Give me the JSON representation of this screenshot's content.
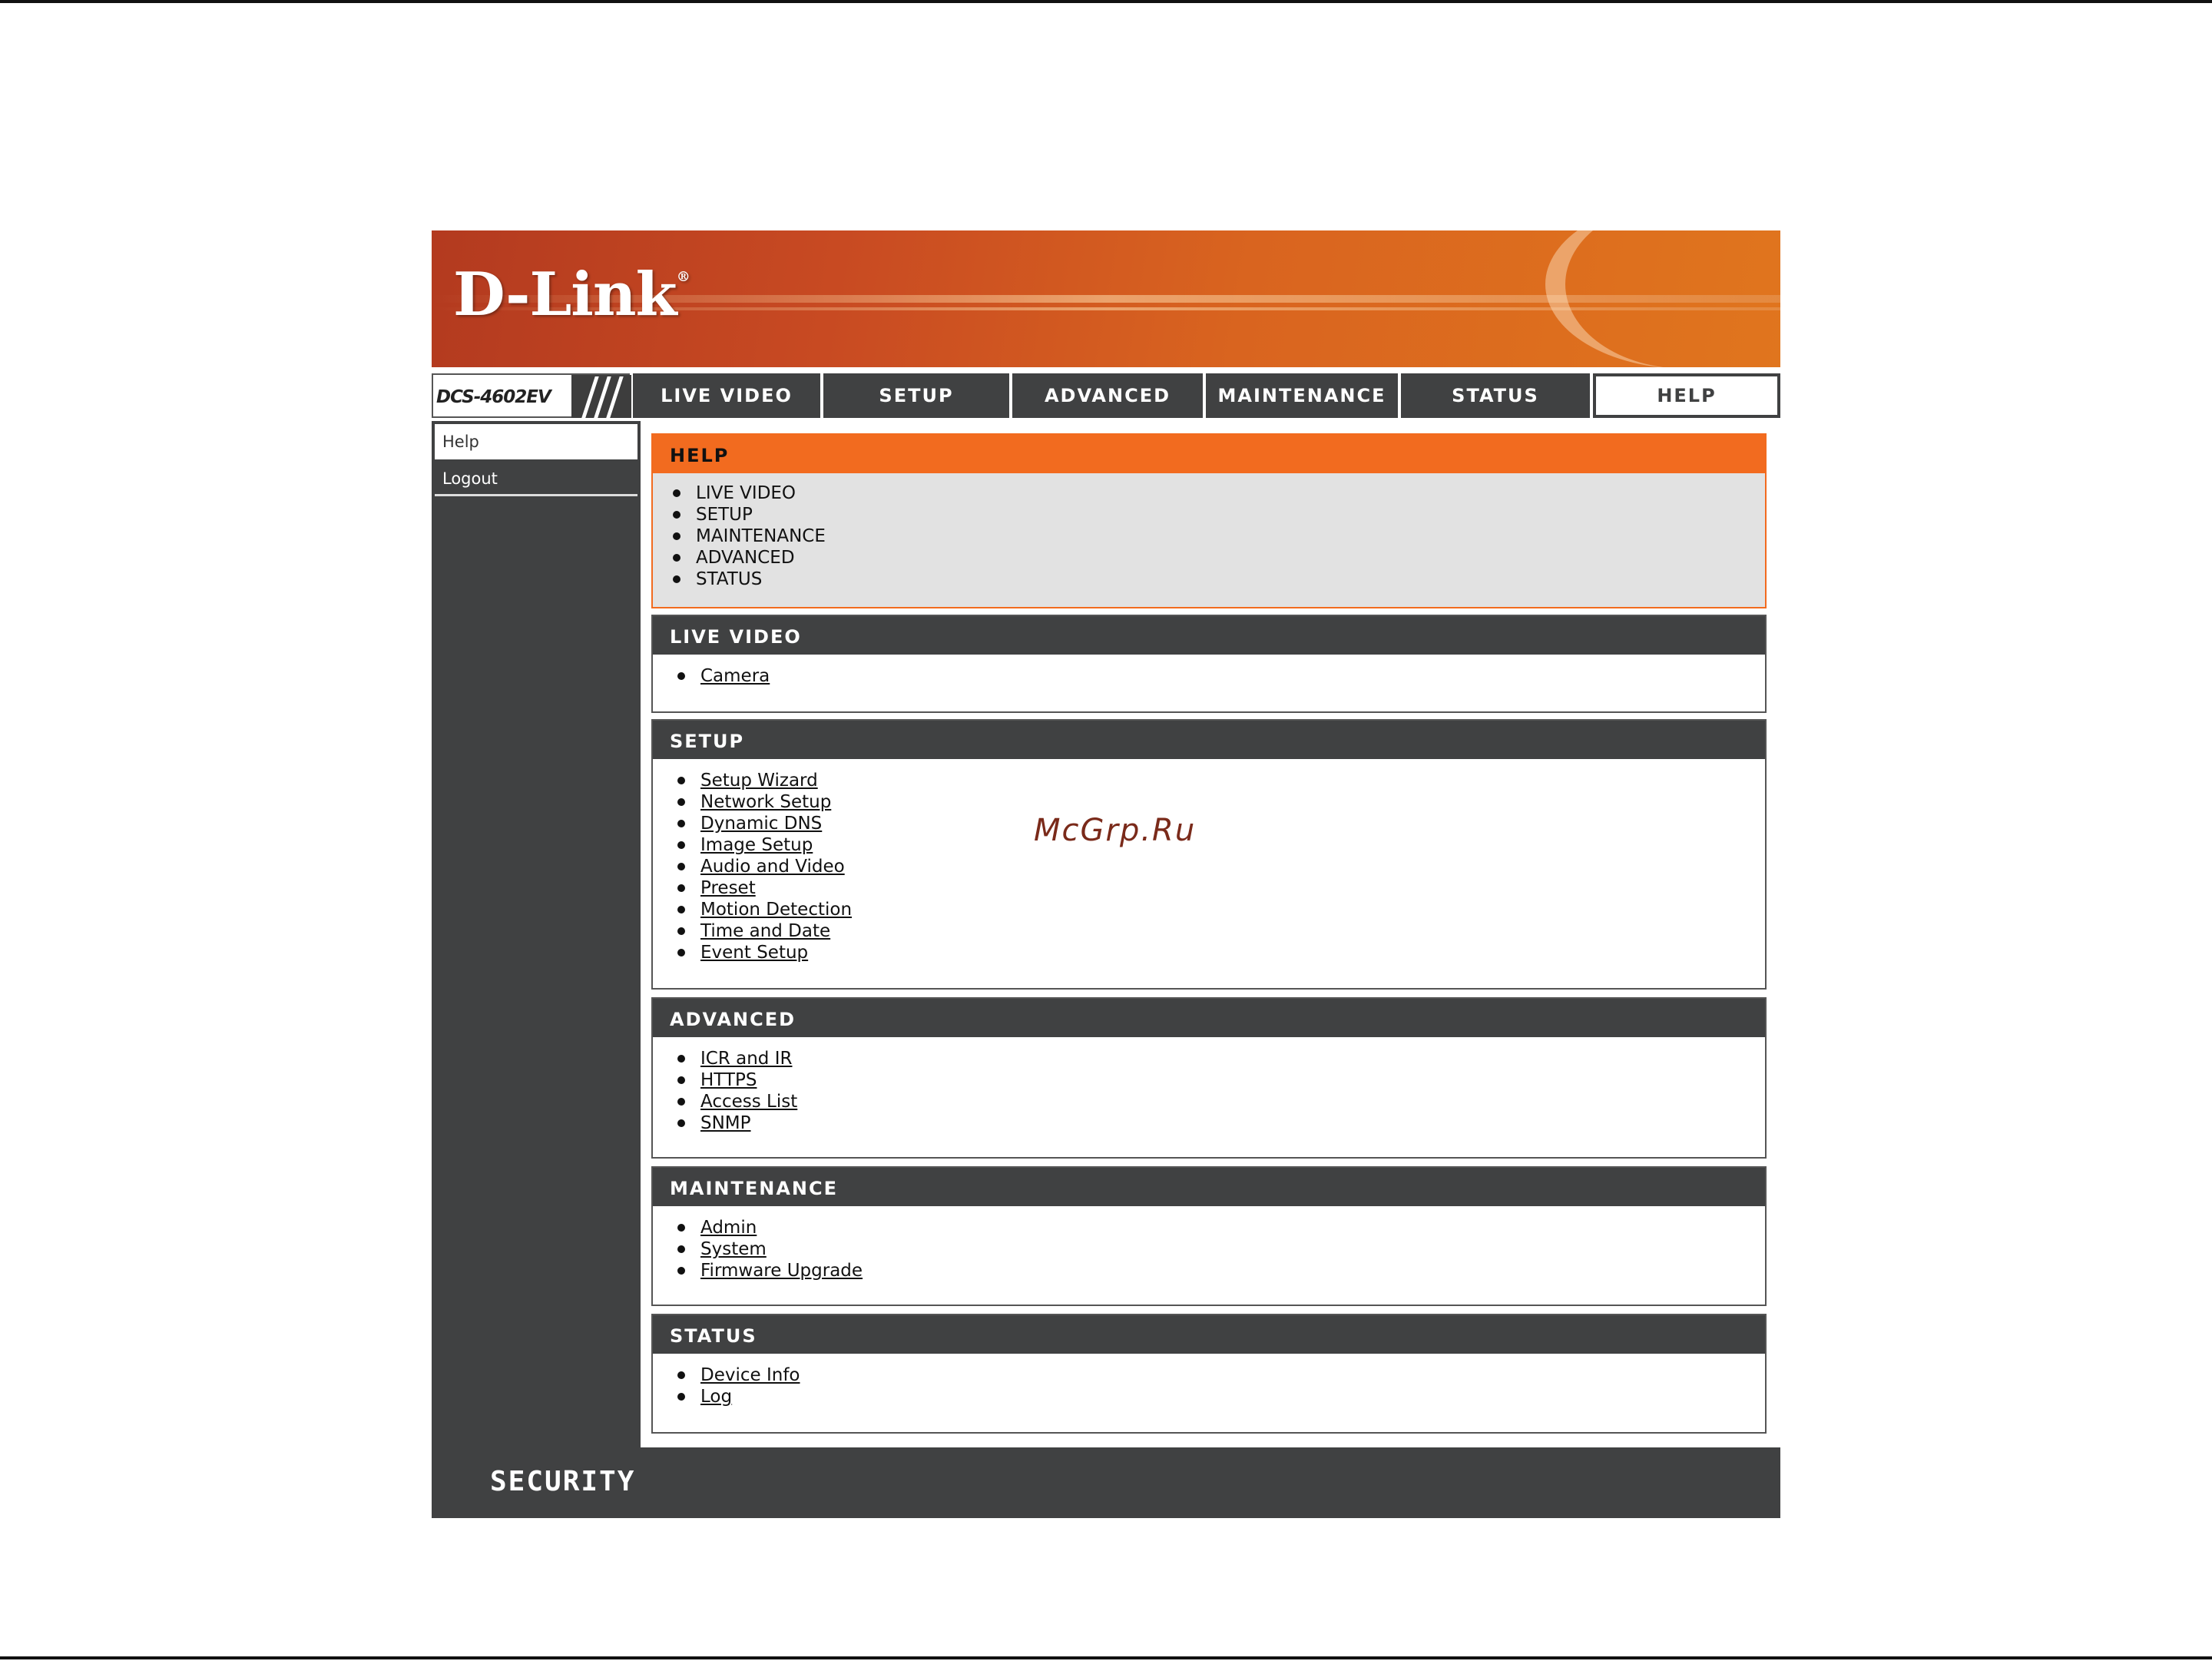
{
  "brand": {
    "logo": "D-Link",
    "reg_mark": "®",
    "model": "DCS-4602EV",
    "footer_label": "SECURITY"
  },
  "nav": {
    "tabs": [
      {
        "label": "LIVE VIDEO"
      },
      {
        "label": "SETUP"
      },
      {
        "label": "ADVANCED"
      },
      {
        "label": "MAINTENANCE"
      },
      {
        "label": "STATUS"
      },
      {
        "label": "HELP",
        "active": true
      }
    ]
  },
  "sidebar": {
    "items": [
      {
        "label": "Help"
      },
      {
        "label": "Logout"
      }
    ]
  },
  "sections": {
    "help": {
      "title": "HELP",
      "items": [
        "LIVE VIDEO",
        "SETUP",
        "MAINTENANCE",
        "ADVANCED",
        "STATUS"
      ]
    },
    "live_video": {
      "title": "LIVE VIDEO",
      "items": [
        "Camera"
      ]
    },
    "setup": {
      "title": "SETUP",
      "items": [
        "Setup Wizard",
        "Network Setup",
        "Dynamic DNS",
        "Image Setup",
        "Audio and Video",
        "Preset",
        "Motion Detection",
        "Time and Date",
        "Event Setup"
      ]
    },
    "advanced": {
      "title": "ADVANCED",
      "items": [
        "ICR and IR",
        "HTTPS",
        "Access List",
        "SNMP"
      ]
    },
    "maintenance": {
      "title": "MAINTENANCE",
      "items": [
        "Admin",
        "System",
        "Firmware Upgrade"
      ]
    },
    "status": {
      "title": "STATUS",
      "items": [
        "Device Info",
        "Log"
      ]
    }
  },
  "watermark": "McGrp.Ru",
  "colors": {
    "accent": "#f26b1f",
    "dark": "#404142",
    "panel": "#e2e2e2"
  }
}
